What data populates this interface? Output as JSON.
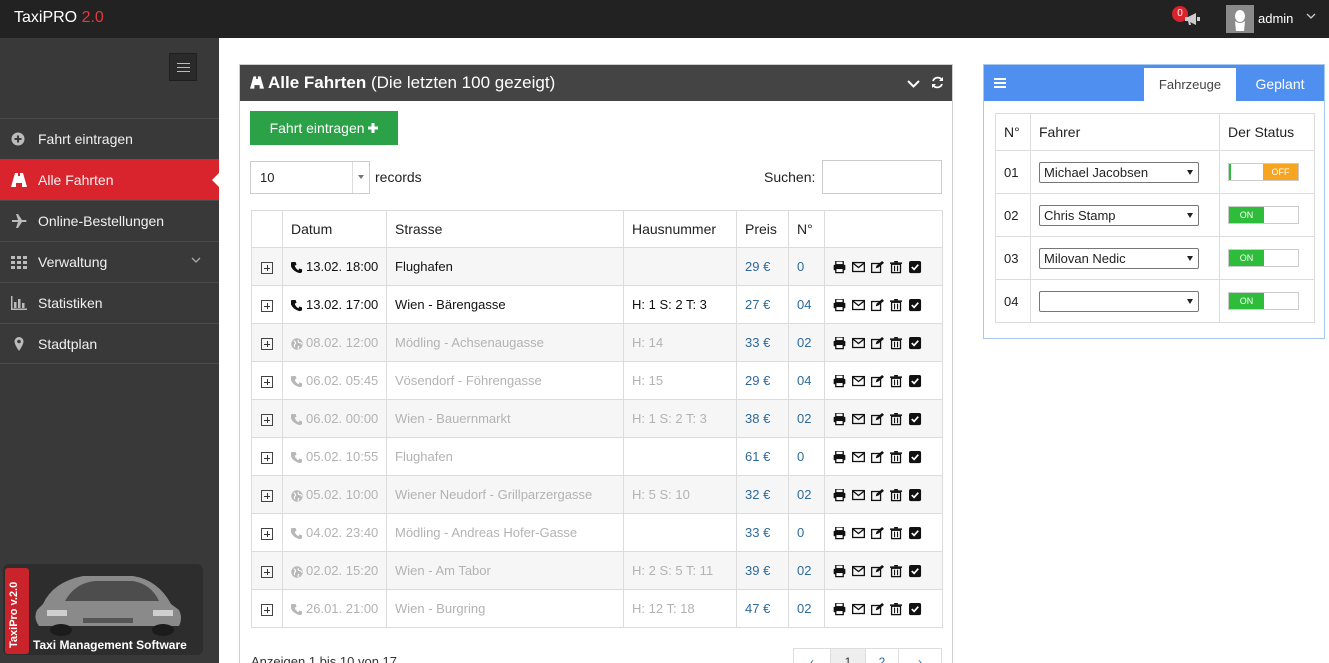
{
  "app": {
    "brand": "TaxiPRO",
    "version": "2.0"
  },
  "header": {
    "notif_count": "0",
    "user": "admin"
  },
  "sidebar": {
    "items": [
      {
        "label": "Fahrt eintragen",
        "icon": "plus-circle-icon"
      },
      {
        "label": "Alle Fahrten",
        "icon": "road-icon",
        "active": true
      },
      {
        "label": "Online-Bestellungen",
        "icon": "plane-icon"
      },
      {
        "label": "Verwaltung",
        "icon": "grid-icon",
        "has_children": true
      },
      {
        "label": "Statistiken",
        "icon": "bar-chart-icon"
      },
      {
        "label": "Stadtplan",
        "icon": "map-marker-icon"
      }
    ],
    "promo": {
      "ribbon": "TaxiPro v.2.0",
      "caption": "Taxi Management Software"
    }
  },
  "main": {
    "title_bold": "Alle Fahrten",
    "title_rest": "(Die letzten 100 gezeigt)",
    "add_button": "Fahrt eintragen",
    "page_length": "10",
    "records_label": "records",
    "search_label": "Suchen:",
    "search_value": "",
    "columns": [
      "Datum",
      "Strasse",
      "Hausnummer",
      "Preis",
      "N°"
    ],
    "rows": [
      {
        "icon": "phone",
        "datum": "13.02. 18:00",
        "strasse": "Flughafen",
        "haus": "",
        "preis": "29 €",
        "nr": "0",
        "active": true
      },
      {
        "icon": "phone",
        "datum": "13.02. 17:00",
        "strasse": "Wien - Bärengasse",
        "haus": "H: 1 S: 2 T: 3",
        "preis": "27 €",
        "nr": "04",
        "active": true
      },
      {
        "icon": "globe",
        "datum": "08.02. 12:00",
        "strasse": "Mödling - Achsenaugasse",
        "haus": "H: 14",
        "preis": "33 €",
        "nr": "02",
        "active": false
      },
      {
        "icon": "phone",
        "datum": "06.02. 05:45",
        "strasse": "Vösendorf - Föhrengasse",
        "haus": "H: 15",
        "preis": "29 €",
        "nr": "04",
        "active": false
      },
      {
        "icon": "phone",
        "datum": "06.02. 00:00",
        "strasse": "Wien - Bauernmarkt",
        "haus": "H: 1 S: 2 T: 3",
        "preis": "38 €",
        "nr": "02",
        "active": false
      },
      {
        "icon": "phone",
        "datum": "05.02. 10:55",
        "strasse": "Flughafen",
        "haus": "",
        "preis": "61 €",
        "nr": "0",
        "active": false
      },
      {
        "icon": "globe",
        "datum": "05.02. 10:00",
        "strasse": "Wiener Neudorf - Grillparzergasse",
        "haus": "H: 5 S: 10",
        "preis": "32 €",
        "nr": "02",
        "active": false
      },
      {
        "icon": "phone",
        "datum": "04.02. 23:40",
        "strasse": "Mödling - Andreas Hofer-Gasse",
        "haus": "",
        "preis": "33 €",
        "nr": "0",
        "active": false
      },
      {
        "icon": "globe",
        "datum": "02.02. 15:20",
        "strasse": "Wien - Am Tabor",
        "haus": "H: 2 S: 5 T: 11",
        "preis": "39 €",
        "nr": "02",
        "active": false
      },
      {
        "icon": "phone",
        "datum": "26.01. 21:00",
        "strasse": "Wien - Burgring",
        "haus": "H: 12 T: 18",
        "preis": "47 €",
        "nr": "02",
        "active": false
      }
    ],
    "footer": "Anzeigen 1 bis 10 von 17",
    "pager": [
      "‹",
      "1",
      "2",
      "›"
    ]
  },
  "vehicles": {
    "tabs": [
      "Fahrzeuge",
      "Geplant"
    ],
    "columns": [
      "N°",
      "Fahrer",
      "Der Status"
    ],
    "rows": [
      {
        "nr": "01",
        "driver": "Michael Jacobsen",
        "status": "OFF"
      },
      {
        "nr": "02",
        "driver": "Chris Stamp",
        "status": "ON"
      },
      {
        "nr": "03",
        "driver": "Milovan Nedic",
        "status": "ON"
      },
      {
        "nr": "04",
        "driver": "",
        "status": "ON"
      }
    ]
  },
  "colors": {
    "brand_red": "#d9232d",
    "accent_blue": "#4f8ff0",
    "green": "#2ba148"
  }
}
